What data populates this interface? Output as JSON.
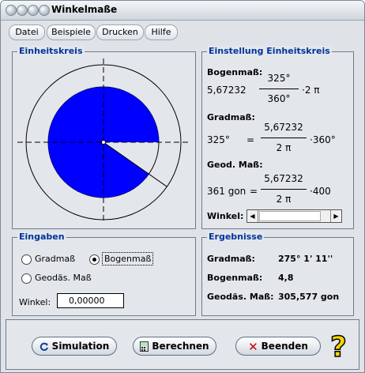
{
  "window": {
    "title": "Winkelmaße"
  },
  "menu": {
    "items": [
      {
        "label": "Datei"
      },
      {
        "label": "Beispiele"
      },
      {
        "label": "Drucken"
      },
      {
        "label": "Hilfe"
      }
    ]
  },
  "unit_circle": {
    "title": "Einheitskreis",
    "angle_degrees": 325
  },
  "settings": {
    "title": "Einstellung Einheitskreis",
    "bogenmass": {
      "label": "Bogenmaß:",
      "value": "5,67232",
      "numerator": "325°",
      "denominator": "360°",
      "suffix": "·2 π"
    },
    "gradmass": {
      "label": "Gradmaß:",
      "value": "325°",
      "equals": "=",
      "numerator": "5,67232",
      "denominator": "2 π",
      "suffix": "·360°"
    },
    "geod": {
      "label": "Geod. Maß:",
      "value": "361 gon",
      "equals": "=",
      "numerator": "5,67232",
      "denominator": "2 π",
      "suffix": "·400"
    },
    "winkel_label": "Winkel:",
    "slider_fraction": 0.1
  },
  "inputs": {
    "title": "Eingaben",
    "options": [
      {
        "label": "Gradmaß",
        "selected": false
      },
      {
        "label": "Bogenmaß",
        "selected": true
      },
      {
        "label": "Geodäs. Maß",
        "selected": false
      }
    ],
    "winkel_label": "Winkel:",
    "winkel_value": "0,00000"
  },
  "results": {
    "title": "Ergebnisse",
    "rows": [
      {
        "label": "Gradmaß:",
        "value": "275° 1' 11''"
      },
      {
        "label": "Bogenmaß:",
        "value": "4,8"
      },
      {
        "label": "Geodäs. Maß:",
        "value": "305,577 gon"
      }
    ]
  },
  "buttons": {
    "simulation": "Simulation",
    "berechnen": "Berechnen",
    "beenden": "Beenden",
    "help_icon": "help-question-icon"
  },
  "colors": {
    "sector": "#0000ff",
    "title_blue": "#00339a",
    "close_x": "#cc0000",
    "help_yellow": "#f5d400"
  }
}
